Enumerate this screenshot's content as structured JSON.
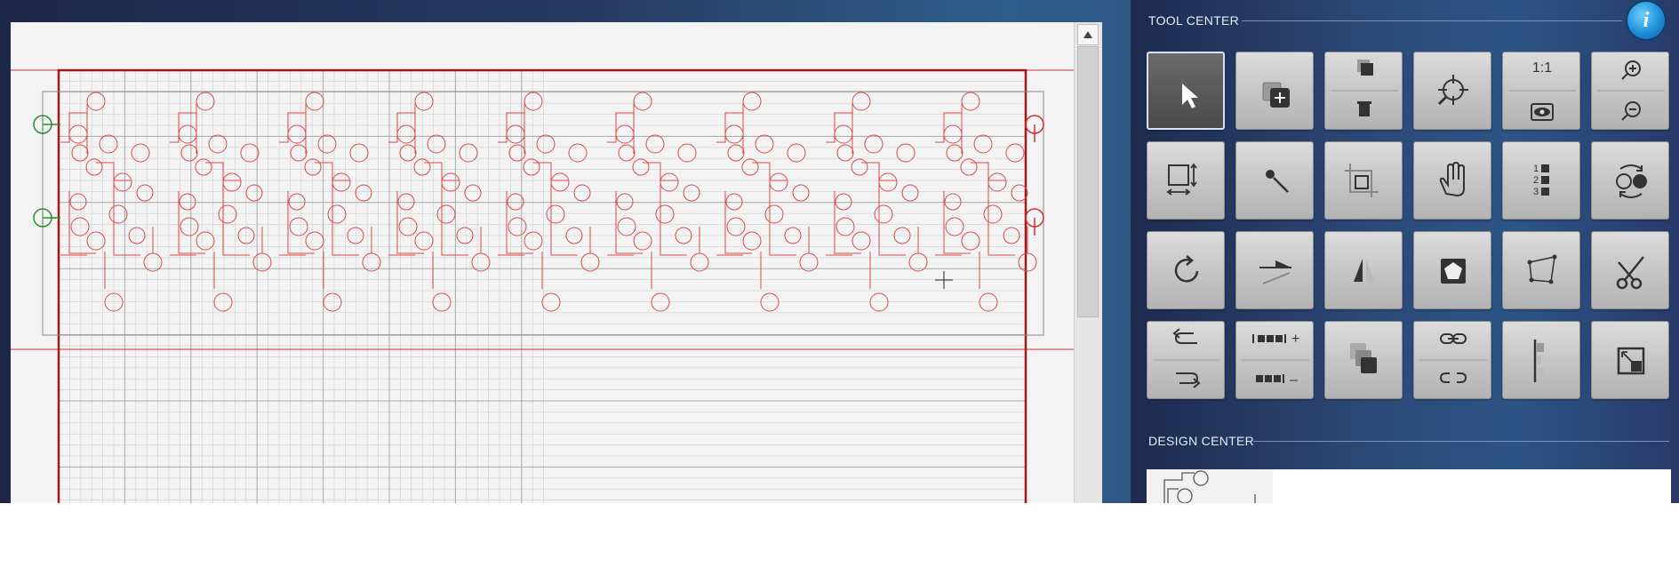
{
  "colors": {
    "design_line": "#d84a4a",
    "mat_border": "#a01818",
    "grid_fine": "#d3d3d3",
    "grid_major": "#a8a8a8",
    "registration_green": "#2e8b2e",
    "registration_red": "#d03030",
    "panel_text": "#e8eef8"
  },
  "tool_center": {
    "title": "TOOL CENTER",
    "info_icon_label": "i",
    "tools": [
      {
        "name": "select-tool",
        "icon": "cursor-arrow-icon",
        "selected": true
      },
      {
        "name": "duplicate-add-tool",
        "icon": "duplicate-plus-icon"
      },
      {
        "name": "copy-delete-tool",
        "icon": "copy-trash-icon"
      },
      {
        "name": "center-target-tool",
        "icon": "crosshair-magnifier-icon"
      },
      {
        "name": "actual-size-preview-tool",
        "icon": "ratio-eye-icon",
        "label": "1:1"
      },
      {
        "name": "zoom-tool",
        "icon": "zoom-in-out-icon"
      },
      {
        "name": "resize-tool",
        "icon": "resize-arrows-icon"
      },
      {
        "name": "magic-wand-tool",
        "icon": "wand-icon"
      },
      {
        "name": "crop-tool",
        "icon": "crop-icon"
      },
      {
        "name": "pan-tool",
        "icon": "hand-icon"
      },
      {
        "name": "order-tool",
        "icon": "numbered-list-icon"
      },
      {
        "name": "replace-tool",
        "icon": "swap-circles-icon"
      },
      {
        "name": "rotate-tool",
        "icon": "rotate-icon"
      },
      {
        "name": "slant-tool",
        "icon": "skew-icon"
      },
      {
        "name": "mirror-tool",
        "icon": "mirror-triangle-icon"
      },
      {
        "name": "shape-tool",
        "icon": "pentagon-icon"
      },
      {
        "name": "node-edit-tool",
        "icon": "node-polygon-icon"
      },
      {
        "name": "cut-tool",
        "icon": "scissors-icon"
      },
      {
        "name": "undo-redo-tool",
        "icon": "undo-redo-arrows-icon"
      },
      {
        "name": "array-add-remove-tool",
        "icon": "array-plus-minus-icon",
        "plus": "+",
        "minus": "–"
      },
      {
        "name": "group-layer-tool",
        "icon": "stack-icon"
      },
      {
        "name": "link-unlink-tool",
        "icon": "link-chain-icon"
      },
      {
        "name": "align-tool",
        "icon": "align-left-bars-icon"
      },
      {
        "name": "fit-to-mat-tool",
        "icon": "fit-box-icon"
      }
    ]
  },
  "design_center": {
    "title": "DESIGN CENTER"
  },
  "canvas": {
    "scroll_up_icon": "triangle-up-icon"
  }
}
